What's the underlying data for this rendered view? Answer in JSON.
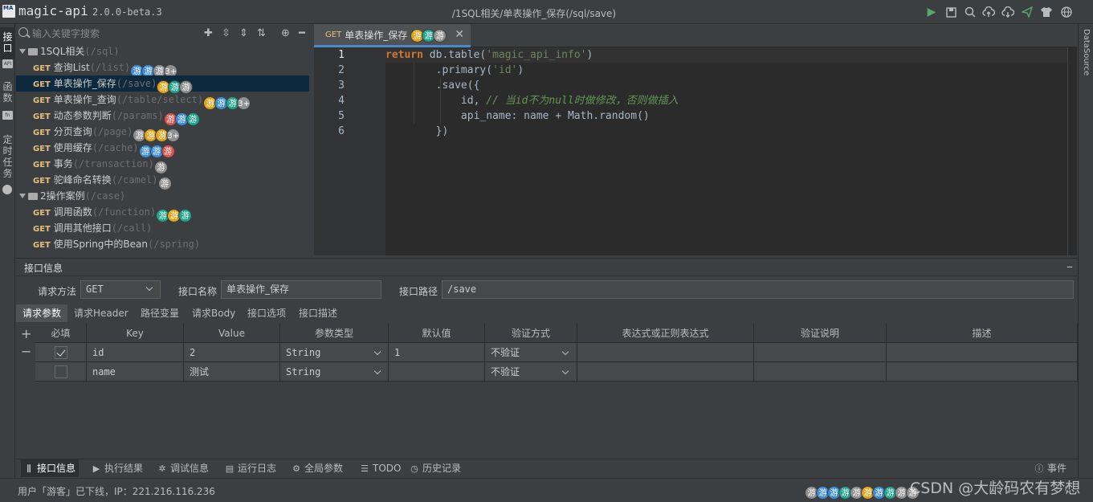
{
  "app": {
    "name": "magic-api",
    "version": "2.0.0-beta.3",
    "logo_text": "MA",
    "breadcrumb": "/1SQL相关/单表操作_保存(/sql/save)"
  },
  "toolbar_icons": [
    "run-icon",
    "save-icon",
    "search-icon",
    "cloud-upload-icon",
    "cloud-download-icon",
    "send-icon",
    "github-icon",
    "theme-shirt-icon",
    "globe-icon"
  ],
  "left_tabs": [
    {
      "label": "接口"
    },
    {
      "label": "函数"
    },
    {
      "label": "定时任务"
    }
  ],
  "search": {
    "placeholder": "输入关键字搜索"
  },
  "tree": {
    "groups": [
      {
        "name": "1SQL相关",
        "path": "(/sql)",
        "items": [
          {
            "method": "GET",
            "name": "查询List",
            "path": "(/list)",
            "avatars": [
              "游",
              "游",
              "游",
              "3+"
            ],
            "colors": [
              "#3d8dd9",
              "#3d8dd9",
              "#909090",
              "#909090"
            ]
          },
          {
            "method": "GET",
            "name": "单表操作_保存",
            "path": "(/save)",
            "avatars": [
              "游",
              "游",
              "游"
            ],
            "colors": [
              "#e2a41a",
              "#20a38b",
              "#909090"
            ],
            "selected": true
          },
          {
            "method": "GET",
            "name": "单表操作_查询",
            "path": "(/table/select)",
            "avatars": [
              "游",
              "游",
              "游",
              "3+"
            ],
            "colors": [
              "#e2a41a",
              "#3d8dd9",
              "#20a38b",
              "#909090"
            ]
          },
          {
            "method": "GET",
            "name": "动态参数判断",
            "path": "(/params)",
            "avatars": [
              "游",
              "游",
              "游"
            ],
            "colors": [
              "#d9534f",
              "#3d8dd9",
              "#20a38b"
            ]
          },
          {
            "method": "GET",
            "name": "分页查询",
            "path": "(/page)",
            "avatars": [
              "游",
              "游",
              "游",
              "3+"
            ],
            "colors": [
              "#909090",
              "#e2a41a",
              "#e2a41a",
              "#909090"
            ]
          },
          {
            "method": "GET",
            "name": "使用缓存",
            "path": "(/cache)",
            "avatars": [
              "游",
              "游",
              "游"
            ],
            "colors": [
              "#3d8dd9",
              "#3d8dd9",
              "#d9534f"
            ]
          },
          {
            "method": "GET",
            "name": "事务",
            "path": "(/transaction)",
            "avatars": [
              "游"
            ],
            "colors": [
              "#909090"
            ]
          },
          {
            "method": "GET",
            "name": "驼峰命名转换",
            "path": "(/camel)",
            "avatars": [
              "游"
            ],
            "colors": [
              "#909090"
            ]
          }
        ]
      },
      {
        "name": "2操作案例",
        "path": "(/case)",
        "items": [
          {
            "method": "GET",
            "name": "调用函数",
            "path": "(/function)",
            "avatars": [
              "游",
              "游",
              "游"
            ],
            "colors": [
              "#20a38b",
              "#e2a41a",
              "#20a38b"
            ]
          },
          {
            "method": "GET",
            "name": "调用其他接口",
            "path": "(/call)",
            "avatars": [],
            "colors": []
          },
          {
            "method": "GET",
            "name": "使用Spring中的Bean",
            "path": "(/spring)",
            "avatars": [],
            "colors": []
          }
        ]
      }
    ]
  },
  "editor": {
    "tab": {
      "method": "GET",
      "name": "单表操作_保存",
      "avatars": [
        "游",
        "游",
        "游"
      ],
      "colors": [
        "#e2a41a",
        "#20a38b",
        "#909090"
      ]
    },
    "line_numbers": [
      "1",
      "2",
      "3",
      "4",
      "5",
      "6"
    ]
  },
  "right_tab": {
    "label": "DataSource"
  },
  "info": {
    "title": "接口信息",
    "method_label": "请求方法",
    "method_value": "GET",
    "name_label": "接口名称",
    "name_value": "单表操作_保存",
    "path_label": "接口路径",
    "path_value": "/save",
    "tabs": [
      "请求参数",
      "请求Header",
      "路径变量",
      "请求Body",
      "接口选项",
      "接口描述"
    ],
    "columns": [
      "必填",
      "Key",
      "Value",
      "参数类型",
      "默认值",
      "验证方式",
      "表达式或正则表达式",
      "验证说明",
      "描述"
    ],
    "rows": [
      {
        "required": true,
        "key": "id",
        "value": "2",
        "type": "String",
        "default": "1",
        "validate": "不验证"
      },
      {
        "required": false,
        "key": "name",
        "value": "测试",
        "type": "String",
        "default": "",
        "validate": "不验证"
      }
    ]
  },
  "bottom_tabs": [
    {
      "label": "接口信息",
      "icon": "columns-icon"
    },
    {
      "label": "执行结果",
      "icon": "play-icon"
    },
    {
      "label": "调试信息",
      "icon": "bug-icon"
    },
    {
      "label": "运行日志",
      "icon": "log-icon"
    },
    {
      "label": "全局参数",
      "icon": "gear-icon"
    },
    {
      "label": "TODO",
      "icon": "list-icon"
    },
    {
      "label": "历史记录",
      "icon": "clock-icon"
    }
  ],
  "events": {
    "label": "事件"
  },
  "status": {
    "text": "用户「游客」已下线，IP：221.216.116.236",
    "avatars": [
      "游",
      "游",
      "游",
      "游",
      "游",
      "游",
      "游",
      "游",
      "游",
      "游"
    ],
    "colors": [
      "#909090",
      "#3d8dd9",
      "#3d8dd9",
      "#20a38b",
      "#909090",
      "#e2a41a",
      "#3d8dd9",
      "#20a38b",
      "#909090",
      "#909090"
    ],
    "watermark": "CSDN @大龄码农有梦想"
  }
}
